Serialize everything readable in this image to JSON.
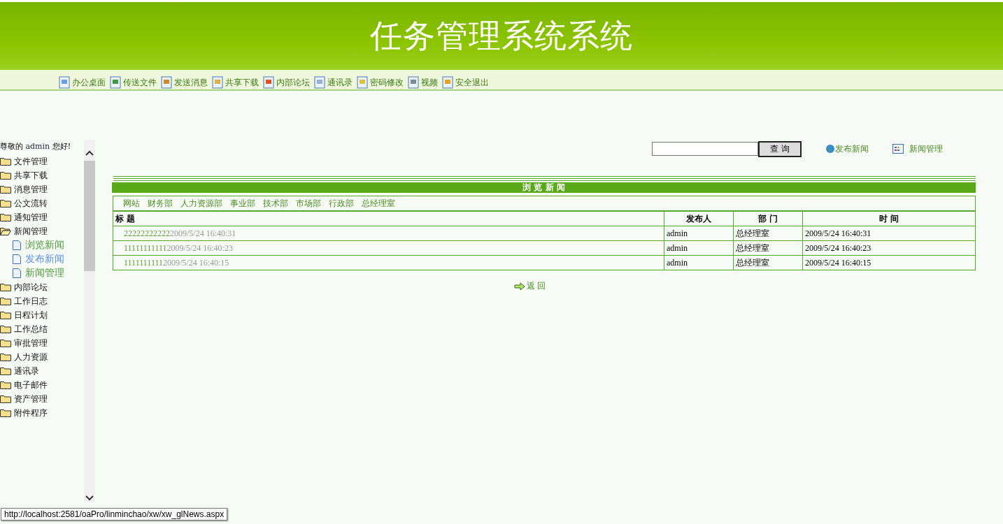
{
  "header": {
    "title": "任务管理系统系统"
  },
  "toolbar": [
    {
      "label": "办公桌面"
    },
    {
      "label": "传送文件"
    },
    {
      "label": "发送消息"
    },
    {
      "label": "共享下载"
    },
    {
      "label": "内部论坛"
    },
    {
      "label": "通讯录"
    },
    {
      "label": "密码修改"
    },
    {
      "label": "视频"
    },
    {
      "label": "安全退出"
    }
  ],
  "sidebar": {
    "greeting_prefix": "尊敬的",
    "user": "admin",
    "greeting_suffix": "您好!",
    "items": [
      {
        "label": "文件管理",
        "expanded": false
      },
      {
        "label": "共享下载",
        "expanded": false
      },
      {
        "label": "消息管理",
        "expanded": false
      },
      {
        "label": "公文流转",
        "expanded": false
      },
      {
        "label": "通知管理",
        "expanded": false
      },
      {
        "label": "新闻管理",
        "expanded": true,
        "children": [
          {
            "label": "浏览新闻",
            "selected": false
          },
          {
            "label": "发布新闻",
            "selected": true
          },
          {
            "label": "新闻管理",
            "selected": false
          }
        ]
      },
      {
        "label": "内部论坛",
        "expanded": false
      },
      {
        "label": "工作日志",
        "expanded": false
      },
      {
        "label": "日程计划",
        "expanded": false
      },
      {
        "label": "工作总结",
        "expanded": false
      },
      {
        "label": "审批管理",
        "expanded": false
      },
      {
        "label": "人力资源",
        "expanded": false
      },
      {
        "label": "通讯录",
        "expanded": false
      },
      {
        "label": "电子邮件",
        "expanded": false
      },
      {
        "label": "资产管理",
        "expanded": false
      },
      {
        "label": "附件程序",
        "expanded": false
      }
    ]
  },
  "search": {
    "button": "查 询",
    "links": [
      {
        "label": "发布新闻",
        "kind": "globe"
      },
      {
        "label": "新闻管理",
        "kind": "grid"
      }
    ]
  },
  "panel": {
    "title": "浏 览 新 闻",
    "departments": [
      "网站",
      "财务部",
      "人力资源部",
      "事业部",
      "技术部",
      "市场部",
      "行政部",
      "总经理室"
    ],
    "columns": [
      "标 题",
      "发布人",
      "部 门",
      "时 间"
    ],
    "rows": [
      {
        "title": "22222222222",
        "date": "2009/5/24 16:40:31",
        "author": "admin",
        "department": "总经理室",
        "time": "2009/5/24 16:40:31"
      },
      {
        "title": "11111111111",
        "date": "2009/5/24 16:40:23",
        "author": "admin",
        "department": "总经理室",
        "time": "2009/5/24 16:40:23"
      },
      {
        "title": "1111111111",
        "date": "2009/5/24 16:40:15",
        "author": "admin",
        "department": "总经理室",
        "time": "2009/5/24 16:40:15"
      }
    ],
    "back": "返 回"
  },
  "status_bar": {
    "url": "http://localhost:2581/oaPro/linminchao/xw/xw_glNews.aspx"
  }
}
